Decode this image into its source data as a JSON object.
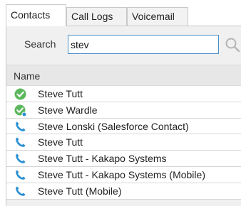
{
  "tabs": [
    {
      "label": "Contacts",
      "active": true
    },
    {
      "label": "Call Logs",
      "active": false
    },
    {
      "label": "Voicemail",
      "active": false
    }
  ],
  "search": {
    "label": "Search",
    "value": "stev"
  },
  "columns": {
    "name": "Name"
  },
  "colors": {
    "available_green": "#5cb85c",
    "phone_blue": "#2a8fd4",
    "focus_border": "#4a90c8"
  },
  "contacts": [
    {
      "name": "Steve Tutt",
      "icon": "presence-available-icon"
    },
    {
      "name": "Steve Wardle",
      "icon": "presence-available-mobile-icon"
    },
    {
      "name": "Steve Lonski (Salesforce Contact)",
      "icon": "phone-icon"
    },
    {
      "name": "Steve Tutt",
      "icon": "phone-icon"
    },
    {
      "name": "Steve Tutt - Kakapo Systems",
      "icon": "phone-icon"
    },
    {
      "name": "Steve Tutt - Kakapo Systems (Mobile)",
      "icon": "phone-icon"
    },
    {
      "name": "Steve Tutt (Mobile)",
      "icon": "phone-icon"
    }
  ]
}
